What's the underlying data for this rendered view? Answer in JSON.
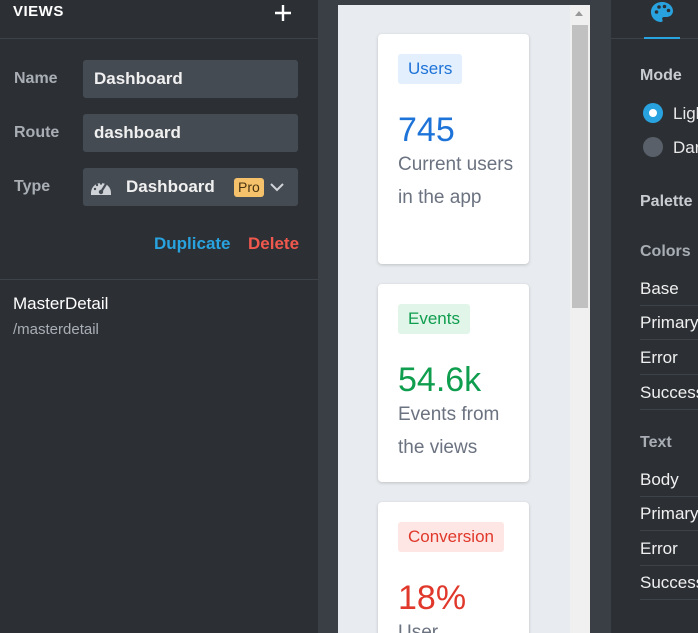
{
  "views_panel": {
    "title": "VIEWS",
    "add_icon": "plus-icon",
    "fields": {
      "name_label": "Name",
      "name_value": "Dashboard",
      "route_label": "Route",
      "route_value": "dashboard",
      "type_label": "Type",
      "type_icon": "dashboard-gauge-icon",
      "type_value": "Dashboard",
      "type_badge": "Pro"
    },
    "actions": {
      "duplicate": "Duplicate",
      "delete": "Delete"
    },
    "items": [
      {
        "name": "MasterDetail",
        "route": "/masterdetail"
      }
    ]
  },
  "preview": {
    "cards": [
      {
        "badge": "Users",
        "value": "745",
        "description": "Current users in the app",
        "color": "#1e73d8",
        "badge_bg": "#e3effc"
      },
      {
        "badge": "Events",
        "value": "54.6k",
        "description": "Events from the views",
        "color": "#0f9d4e",
        "badge_bg": "#e1f5e9"
      },
      {
        "badge": "Conversion",
        "value": "18%",
        "description": "User",
        "color": "#e0382b",
        "badge_bg": "#fde6e4"
      }
    ]
  },
  "theme_panel": {
    "tab_icon": "palette-icon",
    "mode_heading": "Mode",
    "mode_options": [
      {
        "label": "Light",
        "selected": true
      },
      {
        "label": "Dark",
        "selected": false
      }
    ],
    "palette_heading": "Palette",
    "colors_heading": "Colors",
    "colors_items": [
      "Base",
      "Primary",
      "Error",
      "Success"
    ],
    "text_heading": "Text",
    "text_items": [
      "Body",
      "Primary",
      "Error",
      "Success"
    ]
  }
}
